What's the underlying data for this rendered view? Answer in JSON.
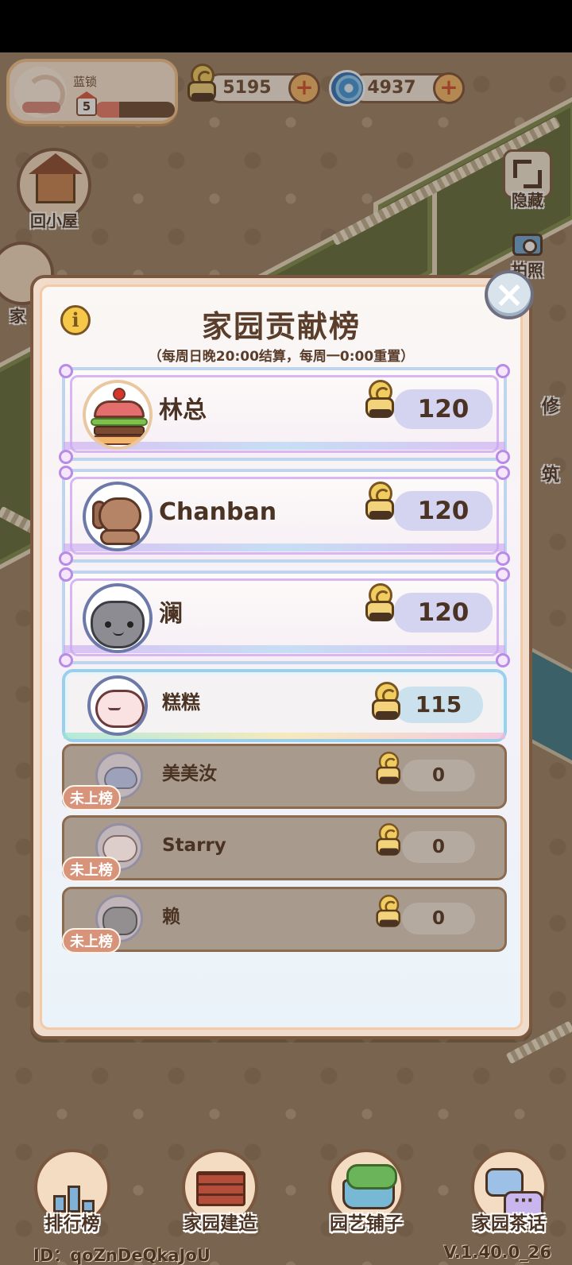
{
  "player": {
    "name": "蓝锁",
    "level": "5",
    "xp_fraction": 0.3
  },
  "currencies": [
    {
      "icon": "snail-coin-icon",
      "value": "5195"
    },
    {
      "icon": "swirl-gem-icon",
      "value": "4937"
    }
  ],
  "left_buttons": [
    {
      "label": "回小屋",
      "icon": "house-icon"
    },
    {
      "label": "家",
      "icon": "gift-icon"
    }
  ],
  "right_buttons": [
    {
      "label": "隐藏",
      "icon": "hide-frame-icon"
    },
    {
      "label": "拍照",
      "icon": "camera-icon"
    }
  ],
  "right_peek": [
    "修",
    "筑"
  ],
  "modal": {
    "title": "家园贡献榜",
    "subtitle": "（每周日晚20:00结算，每周一0:00重置）",
    "info_icon": "i",
    "close_icon": "×"
  },
  "leaderboard": {
    "ranked": [
      {
        "name": "林总",
        "avatar": "burger-cake-avatar",
        "score": "120"
      },
      {
        "name": "Chanban",
        "avatar": "puppy-avatar",
        "score": "120"
      },
      {
        "name": "澜",
        "avatar": "gray-cat-avatar",
        "score": "120"
      },
      {
        "name": "糕糕",
        "avatar": "sheep-avatar",
        "score": "115"
      }
    ],
    "unranked_tag": "未上榜",
    "unranked": [
      {
        "name": "美美汝",
        "avatar": "whale-avatar",
        "score": "0"
      },
      {
        "name": "Starry",
        "avatar": "flower-sheep-avatar",
        "score": "0"
      },
      {
        "name": "赖",
        "avatar": "cat-avatar",
        "score": "0"
      }
    ]
  },
  "bottom_nav": [
    {
      "label": "排行榜",
      "icon": "ranking-podium-icon"
    },
    {
      "label": "家园建造",
      "icon": "bricks-trowel-icon"
    },
    {
      "label": "园艺铺子",
      "icon": "flower-basket-icon"
    },
    {
      "label": "家园茶话",
      "icon": "chat-bubbles-icon"
    }
  ],
  "footer": {
    "id": "ID：qoZnDeQkaJoU",
    "version": "V.1.40.0_26"
  }
}
